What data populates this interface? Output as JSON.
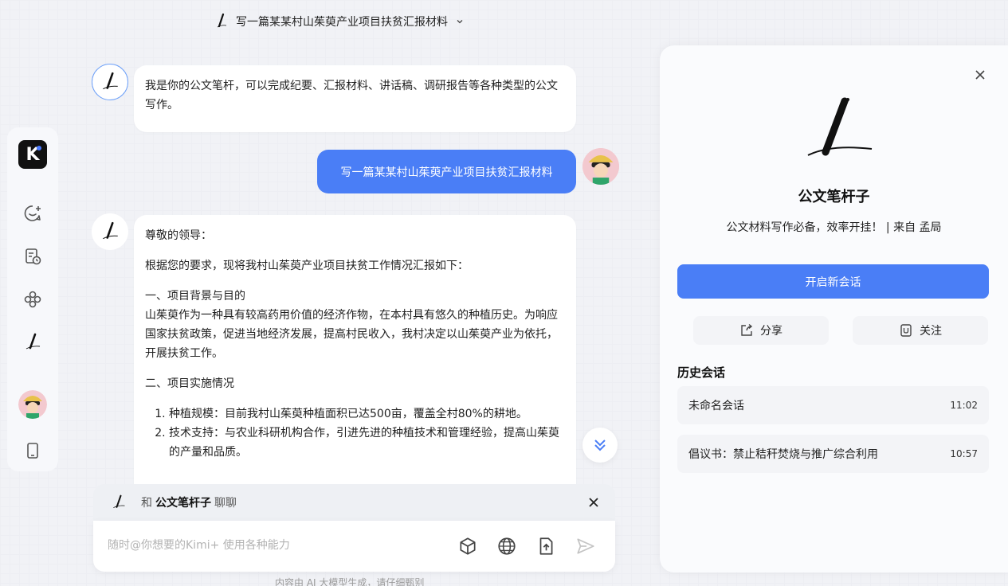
{
  "header": {
    "title": "写一篇某某村山茱萸产业项目扶贫汇报材料",
    "chevron_icon": "chevron-down-icon"
  },
  "sidebar": {
    "logo_text": "K",
    "items": [
      {
        "icon": "new-chat-icon"
      },
      {
        "icon": "history-icon"
      },
      {
        "icon": "explore-icon"
      },
      {
        "icon": "pen-bot-icon"
      },
      {
        "icon": "avatar"
      },
      {
        "icon": "phone-icon"
      }
    ]
  },
  "chat": {
    "intro": "我是你的公文笔杆，可以完成纪要、汇报材料、讲话稿、调研报告等各种类型的公文写作。",
    "user_message": "写一篇某某村山茱萸产业项目扶贫汇报材料",
    "response": {
      "greeting": "尊敬的领导：",
      "lead": "根据您的要求，现将我村山茱萸产业项目扶贫工作情况汇报如下：",
      "section1_title": "一、项目背景与目的",
      "section1_body": "山茱萸作为一种具有较高药用价值的经济作物，在本村具有悠久的种植历史。为响应国家扶贫政策，促进当地经济发展，提高村民收入，我村决定以山茱萸产业为依托，开展扶贫工作。",
      "section2_title": "二、项目实施情况",
      "items": [
        "种植规模：目前我村山茱萸种植面积已达500亩，覆盖全村80%的耕地。",
        "技术支持：与农业科研机构合作，引进先进的种植技术和管理经验，提高山茱萸的产量和品质。"
      ]
    },
    "chat_with": {
      "prefix": "和",
      "name": "公文笔杆子",
      "suffix": "聊聊"
    },
    "input_placeholder": "随时@你想要的Kimi+ 使用各种能力",
    "footnote": "内容由 AI 大模型生成，请仔细甄别"
  },
  "panel": {
    "title": "公文笔杆子",
    "description": "公文材料写作必备，效率开挂！ | 来自 孟局",
    "new_chat": "开启新会话",
    "share": "分享",
    "follow": "关注",
    "history_title": "历史会话",
    "history": [
      {
        "title": "未命名会话",
        "time": "11:02"
      },
      {
        "title": "倡议书：禁止秸秆焚烧与推广综合利用",
        "time": "10:57"
      }
    ]
  },
  "colors": {
    "accent": "#4a7ef6",
    "background": "#f1f2f6"
  }
}
